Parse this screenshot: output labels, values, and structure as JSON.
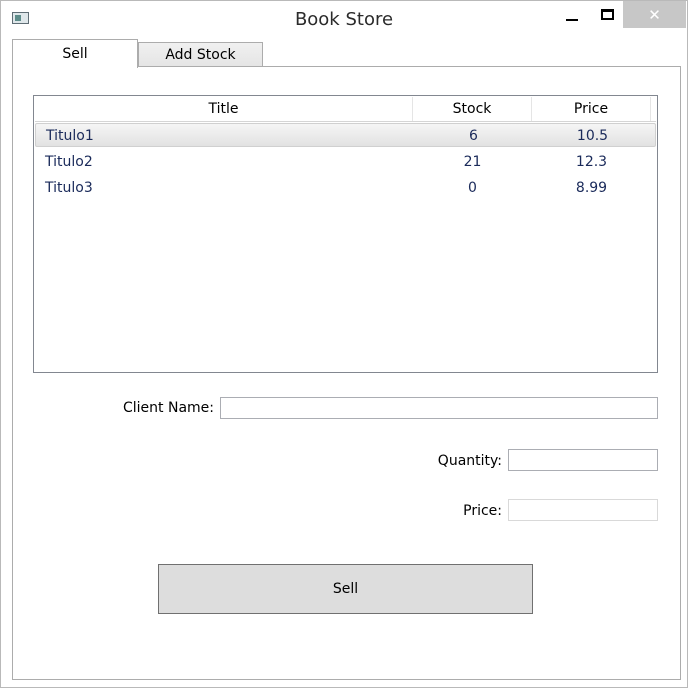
{
  "window": {
    "title": "Book Store",
    "close_glyph": "✕"
  },
  "tabs": [
    {
      "label": "Sell",
      "selected": true
    },
    {
      "label": "Add Stock",
      "selected": false
    }
  ],
  "books_table": {
    "columns": [
      "Title",
      "Stock",
      "Price"
    ],
    "rows": [
      {
        "title": "Titulo1",
        "stock": "6",
        "price": "10.5",
        "selected": true
      },
      {
        "title": "Titulo2",
        "stock": "21",
        "price": "12.3",
        "selected": false
      },
      {
        "title": "Titulo3",
        "stock": "0",
        "price": "8.99",
        "selected": false
      }
    ]
  },
  "form": {
    "client_name_label": "Client Name:",
    "client_name_value": "",
    "quantity_label": "Quantity:",
    "quantity_value": "",
    "price_label": "Price:",
    "price_value": ""
  },
  "sell_button_label": "Sell",
  "icons": {
    "app": "app-window-icon",
    "minimize": "minimize-icon",
    "maximize": "maximize-icon",
    "close": "close-icon"
  }
}
